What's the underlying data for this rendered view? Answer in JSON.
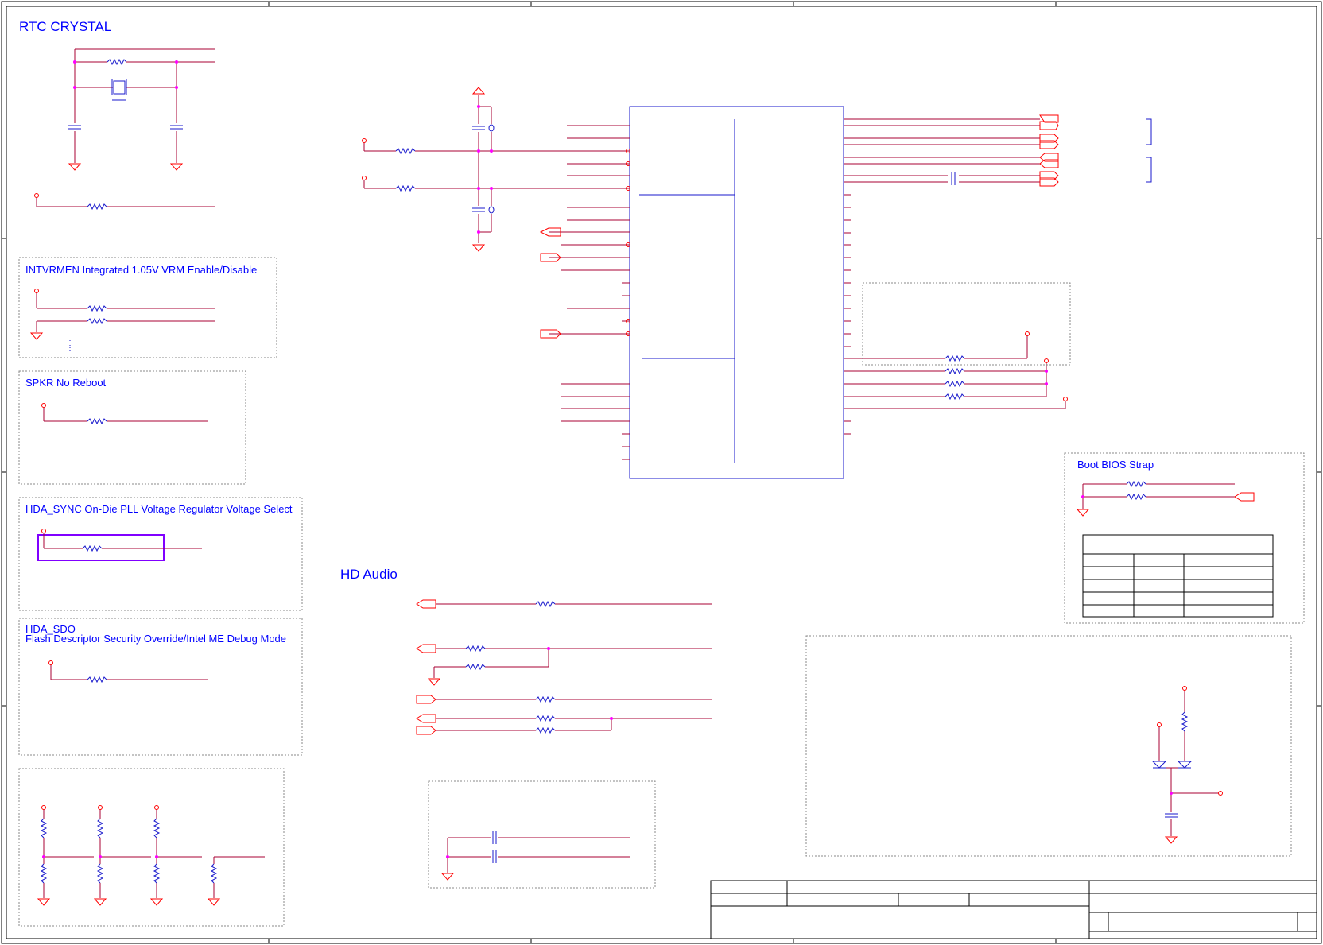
{
  "colors": {
    "wire": "#aa0033",
    "component": "#1a1acc",
    "port": "#ff0000",
    "junction": "#ff00ff",
    "frame": "#000000",
    "box_dashed": "#888888",
    "highlight": "#8000ff",
    "label_text": "#0000ff"
  },
  "sections": {
    "rtc_crystal": "RTC CRYSTAL",
    "intvrmen": "INTVRMEN   Integrated 1.05V VRM Enable/Disable",
    "spkr": "SPKR   No Reboot",
    "hda_sync": "HDA_SYNC   On-Die PLL Voltage Regulator Voltage Select",
    "hda_sdo_line1": "HDA_SDO",
    "hda_sdo_line2": "Flash Descriptor Security Override/Intel ME Debug Mode",
    "hd_audio": "HD Audio",
    "boot_bios_strap": "Boot BIOS Strap"
  },
  "components": {
    "crystal": "crystal-symbol",
    "ic": "pch-block",
    "resistor": "resistor-symbol",
    "capacitor": "capacitor-symbol",
    "ground": "ground-symbol",
    "power": "power-symbol",
    "diode": "diode-symbol"
  },
  "boot_bios_table": {
    "rows": 5,
    "columns": 3
  },
  "title_block": {
    "fields": "empty"
  }
}
